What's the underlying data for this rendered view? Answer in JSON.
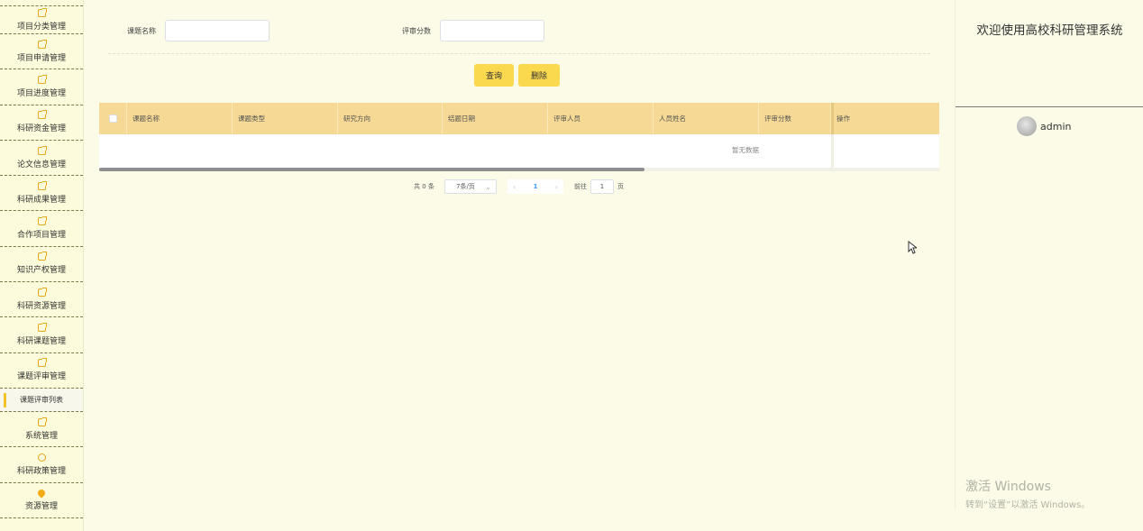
{
  "sidebar": {
    "items": [
      {
        "label": "项目分类管理"
      },
      {
        "label": "项目申请管理"
      },
      {
        "label": "项目进度管理"
      },
      {
        "label": "科研资金管理"
      },
      {
        "label": "论文信息管理"
      },
      {
        "label": "科研成果管理"
      },
      {
        "label": "合作项目管理"
      },
      {
        "label": "知识产权管理"
      },
      {
        "label": "科研资源管理"
      },
      {
        "label": "科研课题管理"
      },
      {
        "label": "课题评审管理"
      }
    ],
    "active_sub": "课题评审列表",
    "items_after": [
      {
        "label": "系统管理"
      },
      {
        "label": "科研政策管理"
      },
      {
        "label": "资源管理"
      }
    ]
  },
  "search": {
    "name_label": "课题名称",
    "name_value": "",
    "score_label": "评审分数",
    "score_value": ""
  },
  "buttons": {
    "query": "查询",
    "delete": "删除"
  },
  "table": {
    "columns": [
      "课题名称",
      "课题类型",
      "研究方向",
      "结题日期",
      "评审人员",
      "人员姓名",
      "评审分数",
      "操作"
    ],
    "empty_text": "暂无数据"
  },
  "pager": {
    "total": "共 0 条",
    "page_size": "7条/页",
    "prev": "‹",
    "current": "1",
    "next": "›",
    "goto_label": "前往",
    "goto_value": "1",
    "page_suffix": "页"
  },
  "right_panel": {
    "welcome": "欢迎使用高校科研管理系统",
    "username": "admin"
  },
  "watermark": {
    "title": "激活 Windows",
    "subtitle": "转到“设置”以激活 Windows。"
  }
}
